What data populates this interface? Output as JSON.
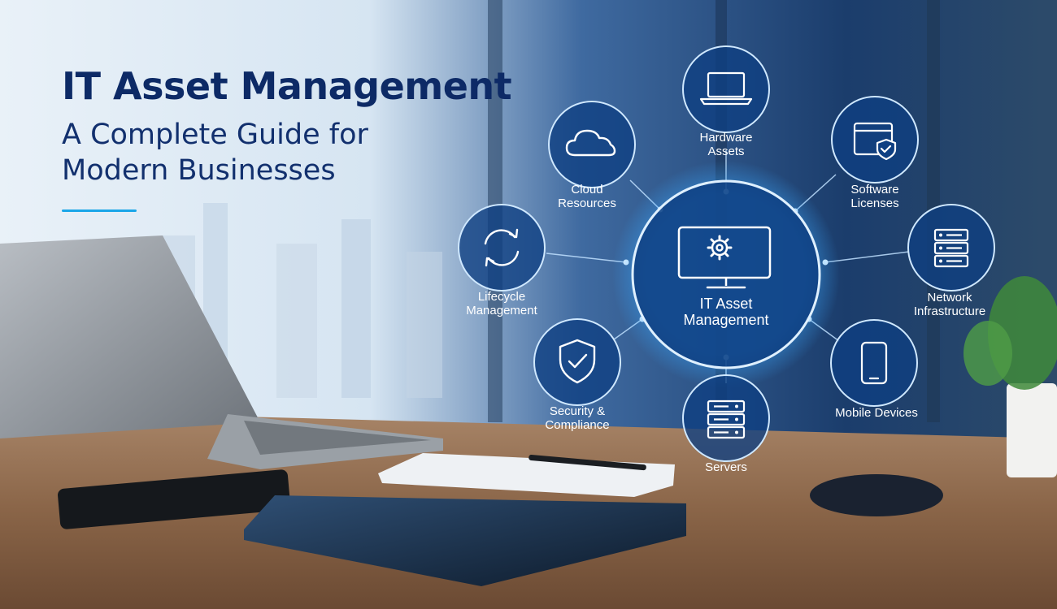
{
  "hero": {
    "title": "IT Asset Management",
    "subtitle_line1": "A Complete Guide for",
    "subtitle_line2": "Modern Businesses"
  },
  "hub": {
    "icon": "monitor-gear-icon",
    "label_line1": "IT Asset",
    "label_line2": "Management"
  },
  "nodes": [
    {
      "id": "hardware-assets",
      "icon": "laptop-icon",
      "label_lines": [
        "Hardware",
        "Assets"
      ]
    },
    {
      "id": "software-licenses",
      "icon": "window-shield-icon",
      "label_lines": [
        "Software",
        "Licenses"
      ]
    },
    {
      "id": "network-infrastructure",
      "icon": "server-rack-icon",
      "label_lines": [
        "Network",
        "Infrastructure"
      ]
    },
    {
      "id": "mobile-devices",
      "icon": "smartphone-icon",
      "label_lines": [
        "Mobile Devices"
      ]
    },
    {
      "id": "servers",
      "icon": "server-stack-icon",
      "label_lines": [
        "Servers"
      ]
    },
    {
      "id": "security-compliance",
      "icon": "shield-check-icon",
      "label_lines": [
        "Security &",
        "Compliance"
      ]
    },
    {
      "id": "lifecycle-management",
      "icon": "refresh-cycle-icon",
      "label_lines": [
        "Lifecycle",
        "Management"
      ]
    },
    {
      "id": "cloud-resources",
      "icon": "cloud-icon",
      "label_lines": [
        "Cloud",
        "Resources"
      ]
    }
  ],
  "colors": {
    "title": "#0d2a66",
    "subtitle": "#12306e",
    "accent_rule": "#1aa6e8",
    "node_fill": "#0e3f82",
    "node_stroke": "#cfe8ff",
    "hub_glow": "#39a8ff"
  }
}
